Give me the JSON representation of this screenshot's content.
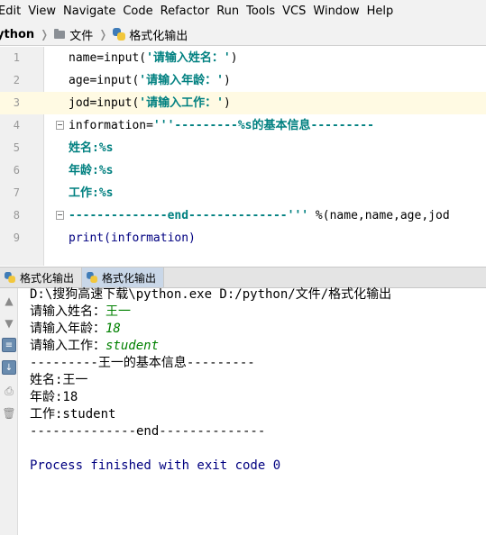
{
  "menu": [
    "Edit",
    "View",
    "Navigate",
    "Code",
    "Refactor",
    "Run",
    "Tools",
    "VCS",
    "Window",
    "Help"
  ],
  "breadcrumb": {
    "project": "ython",
    "folder": "文件",
    "file": "格式化输出"
  },
  "editor": {
    "current_line": 3,
    "lines": [
      {
        "num": "1",
        "parts": [
          {
            "t": "name=input(",
            "c": ""
          },
          {
            "t": "'请输入姓名：'",
            "c": "str"
          },
          {
            "t": ")",
            "c": ""
          }
        ]
      },
      {
        "num": "2",
        "parts": [
          {
            "t": "age=input(",
            "c": ""
          },
          {
            "t": "'请输入年龄：'",
            "c": "str"
          },
          {
            "t": ")",
            "c": ""
          }
        ]
      },
      {
        "num": "3",
        "parts": [
          {
            "t": "jod=input(",
            "c": ""
          },
          {
            "t": "'请输入工作：'",
            "c": "str"
          },
          {
            "t": ")",
            "c": ""
          }
        ]
      },
      {
        "num": "4",
        "parts": [
          {
            "t": "information=",
            "c": ""
          },
          {
            "t": "'''---------%s的基本信息---------",
            "c": "str"
          }
        ]
      },
      {
        "num": "5",
        "parts": [
          {
            "t": "姓名:%s",
            "c": "str"
          }
        ]
      },
      {
        "num": "6",
        "parts": [
          {
            "t": "年龄:%s",
            "c": "str"
          }
        ]
      },
      {
        "num": "7",
        "parts": [
          {
            "t": "工作:%s",
            "c": "str"
          }
        ]
      },
      {
        "num": "8",
        "parts": [
          {
            "t": "--------------end--------------'''",
            "c": "str"
          },
          {
            "t": " %(name,name,age,jod",
            "c": ""
          }
        ]
      },
      {
        "num": "9",
        "parts": [
          {
            "t": "print(information)",
            "c": "builtin"
          }
        ]
      }
    ]
  },
  "run_tabs": [
    {
      "label": "格式化输出",
      "active": false
    },
    {
      "label": "格式化输出",
      "active": true
    }
  ],
  "console": {
    "command": "D:\\搜狗高速下载\\python.exe D:/python/文件/格式化输出",
    "prompts": [
      {
        "label": "请输入姓名：",
        "value": "王一"
      },
      {
        "label": "请输入年龄：",
        "value": "18"
      },
      {
        "label": "请输入工作：",
        "value": "student"
      }
    ],
    "output": [
      "---------王一的基本信息---------",
      "姓名:王一",
      "年龄:18",
      "工作:student",
      "--------------end--------------",
      ""
    ],
    "exit_message": "Process finished with exit code 0"
  },
  "icons": {
    "python": "python-file-icon",
    "folder": "folder-icon",
    "fold": "fold-marker-icon"
  }
}
